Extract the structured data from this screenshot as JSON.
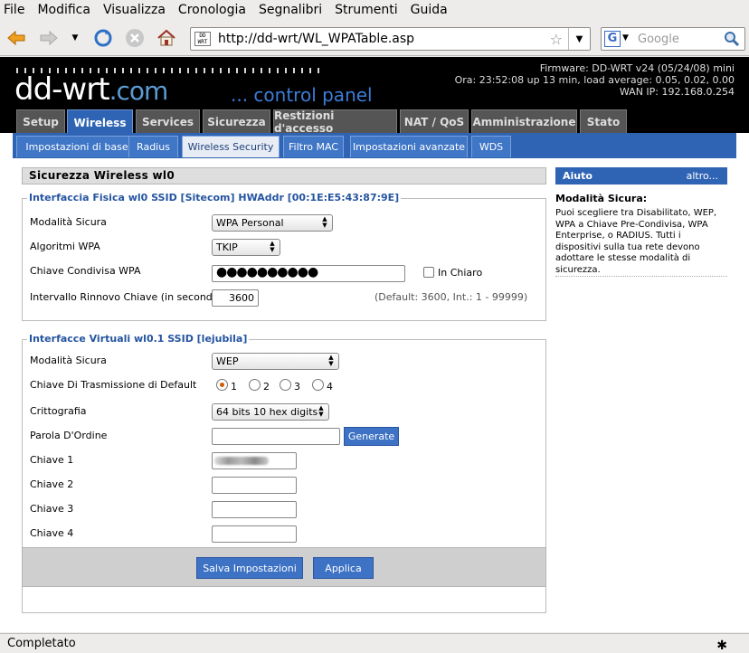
{
  "menubar": {
    "items": [
      "File",
      "Modifica",
      "Visualizza",
      "Cronologia",
      "Segnalibri",
      "Strumenti",
      "Guida"
    ]
  },
  "toolbar": {
    "url": "http://dd-wrt/WL_WPATable.asp",
    "favicon_text": "DD WRT",
    "search_engine": "G",
    "search_placeholder": "Google"
  },
  "header": {
    "logo": "dd-wrt",
    "logo_suffix": ".com",
    "subtitle": "... control panel",
    "firmware": "Firmware: DD-WRT v24 (05/24/08) mini",
    "uptime": "Ora: 23:52:08 up 13 min, load average: 0.05, 0.02, 0.00",
    "wan_ip": "WAN IP: 192.168.0.254"
  },
  "main_tabs": [
    "Setup",
    "Wireless",
    "Services",
    "Sicurezza",
    "Restizioni d'accesso",
    "NAT / QoS",
    "Amministrazione",
    "Stato"
  ],
  "sub_tabs": [
    "Impostazioni di base",
    "Radius",
    "Wireless Security",
    "Filtro MAC",
    "Impostazioni avanzate",
    "WDS"
  ],
  "section_title": "Sicurezza Wireless wl0",
  "physical": {
    "legend": "Interfaccia Fisica wl0 SSID [Sitecom] HWAddr [00:1E:E5:43:87:9E]",
    "mode_label": "Modalità Sicura",
    "mode_value": "WPA Personal",
    "algo_label": "Algoritmi WPA",
    "algo_value": "TKIP",
    "key_label": "Chiave Condivisa WPA",
    "key_value": "●●●●●●●●●●",
    "clear_label": "In Chiaro",
    "renew_label": "Intervallo Rinnovo Chiave (in secondi)",
    "renew_value": "3600",
    "renew_hint": "(Default: 3600, Int.: 1 - 99999)"
  },
  "virtual": {
    "legend": "Interfacce Virtuali wl0.1 SSID [lejubila]",
    "mode_label": "Modalità Sicura",
    "mode_value": "WEP",
    "tx_key_label": "Chiave Di Trasmissione di Default",
    "tx_options": [
      "1",
      "2",
      "3",
      "4"
    ],
    "tx_selected": "1",
    "crypto_label": "Crittografia",
    "crypto_value": "64 bits 10 hex digits",
    "passphrase_label": "Parola D'Ordine",
    "generate_label": "Generate",
    "key1_label": "Chiave 1",
    "key2_label": "Chiave 2",
    "key3_label": "Chiave 3",
    "key4_label": "Chiave 4"
  },
  "actions": {
    "save_label": "Salva Impostazioni",
    "apply_label": "Applica"
  },
  "help": {
    "header": "Aiuto",
    "more": "altro...",
    "title": "Modalità Sicura:",
    "text": "Puoi scegliere tra Disabilitato, WEP, WPA a Chiave Pre-Condivisa, WPA Enterprise, o RADIUS. Tutti i dispositivi sulla tua rete devono adottare le stesse modalità di sicurezza."
  },
  "status": {
    "text": "Completato"
  }
}
